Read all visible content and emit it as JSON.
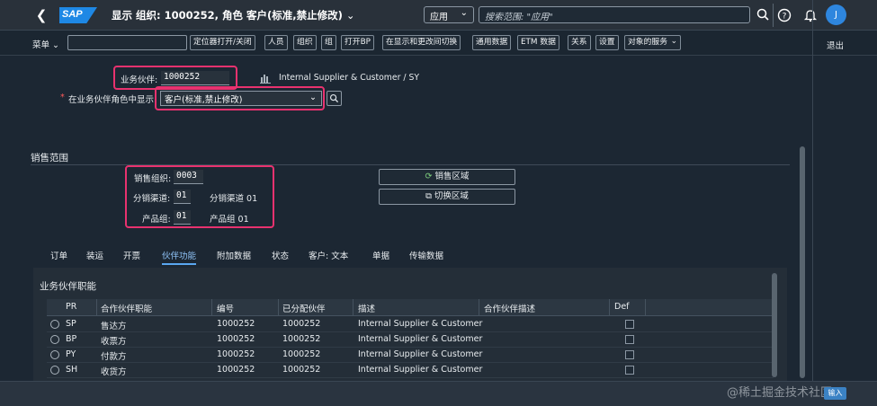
{
  "shell": {
    "logo": "SAP",
    "title": "显示 组织: 1000252, 角色 客户(标准,禁止修改)",
    "scope": "应用",
    "search_placeholder": "搜索范围: \"应用\"",
    "avatar": "J"
  },
  "toolbar": {
    "menu": "菜单",
    "buttons": [
      "定位器打开/关闭",
      "人员",
      "组织",
      "组",
      "打开BP",
      "在显示和更改间切换",
      "通用数据",
      "ETM 数据",
      "关系",
      "设置",
      "对象的服务"
    ],
    "exit": "退出"
  },
  "header": {
    "partner_label": "业务伙伴:",
    "partner_value": "1000252",
    "partner_desc": "Internal Supplier & Customer / SY",
    "role_label": "在业务伙伴角色中显示:",
    "role_required": "*",
    "role_value": "客户(标准,禁止修改)"
  },
  "sales_area": {
    "title": "销售范围",
    "org_label": "销售组织:",
    "org_value": "0003",
    "channel_label": "分销渠道:",
    "channel_value": "01",
    "channel_desc": "分销渠道 01",
    "division_label": "产品组:",
    "division_value": "01",
    "division_desc": "产品组 01",
    "btn_sales_area": "销售区域",
    "btn_switch_area": "切换区域"
  },
  "tabs": [
    "订单",
    "装运",
    "开票",
    "伙伴功能",
    "附加数据",
    "状态",
    "客户: 文本",
    "单据",
    "传输数据"
  ],
  "active_tab": "伙伴功能",
  "partner_functions": {
    "title": "业务伙伴职能",
    "columns": [
      "PR",
      "合作伙伴职能",
      "编号",
      "已分配伙伴",
      "描述",
      "合作伙伴描述",
      "Def"
    ],
    "rows": [
      {
        "pr": "SP",
        "func": "售达方",
        "num": "1000252",
        "assigned": "1000252",
        "desc": "Internal Supplier & Customer",
        "pdesc": ""
      },
      {
        "pr": "BP",
        "func": "收票方",
        "num": "1000252",
        "assigned": "1000252",
        "desc": "Internal Supplier & Customer",
        "pdesc": ""
      },
      {
        "pr": "PY",
        "func": "付款方",
        "num": "1000252",
        "assigned": "1000252",
        "desc": "Internal Supplier & Customer",
        "pdesc": ""
      },
      {
        "pr": "SH",
        "func": "收货方",
        "num": "1000252",
        "assigned": "1000252",
        "desc": "Internal Supplier & Customer",
        "pdesc": ""
      }
    ]
  },
  "status": {
    "enter": "输入",
    "watermark": "@稀土掘金技术社区"
  },
  "colors": {
    "accent": "#e8326f",
    "brand": "#1e88e5",
    "active_tab": "#8fc3f7"
  }
}
